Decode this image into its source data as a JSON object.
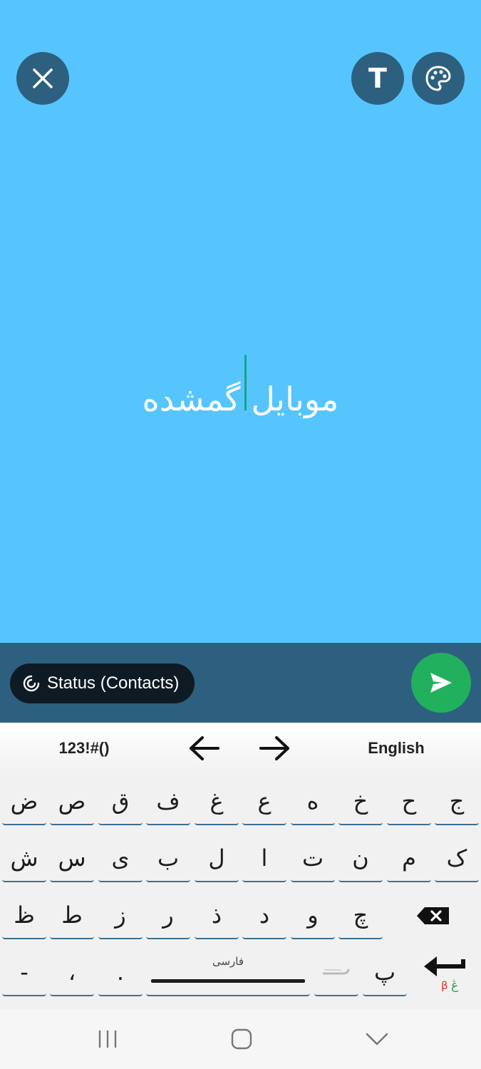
{
  "editor": {
    "status_text": "موبایل گمشده"
  },
  "send_bar": {
    "audience_label": "Status (Contacts)"
  },
  "keyboard": {
    "toolbar": {
      "symbols_label": "123!#()",
      "language_label": "English"
    },
    "row1": [
      "ض",
      "ص",
      "ق",
      "ف",
      "غ",
      "ع",
      "ه",
      "خ",
      "ح",
      "ج"
    ],
    "row2": [
      "ش",
      "س",
      "ی",
      "ب",
      "ل",
      "ا",
      "ت",
      "ن",
      "م",
      "ک"
    ],
    "row3": [
      "ظ",
      "ط",
      "ز",
      "ر",
      "ذ",
      "د",
      "و",
      "چ"
    ],
    "row4": {
      "dash": "-",
      "comma": "،",
      "period": ".",
      "space_label": "فارسی",
      "pe": "پ"
    }
  },
  "colors": {
    "canvas_background": "#56c5fd",
    "icon_button": "#2d607f",
    "send_button": "#21b15d",
    "caret": "#12a58e"
  }
}
